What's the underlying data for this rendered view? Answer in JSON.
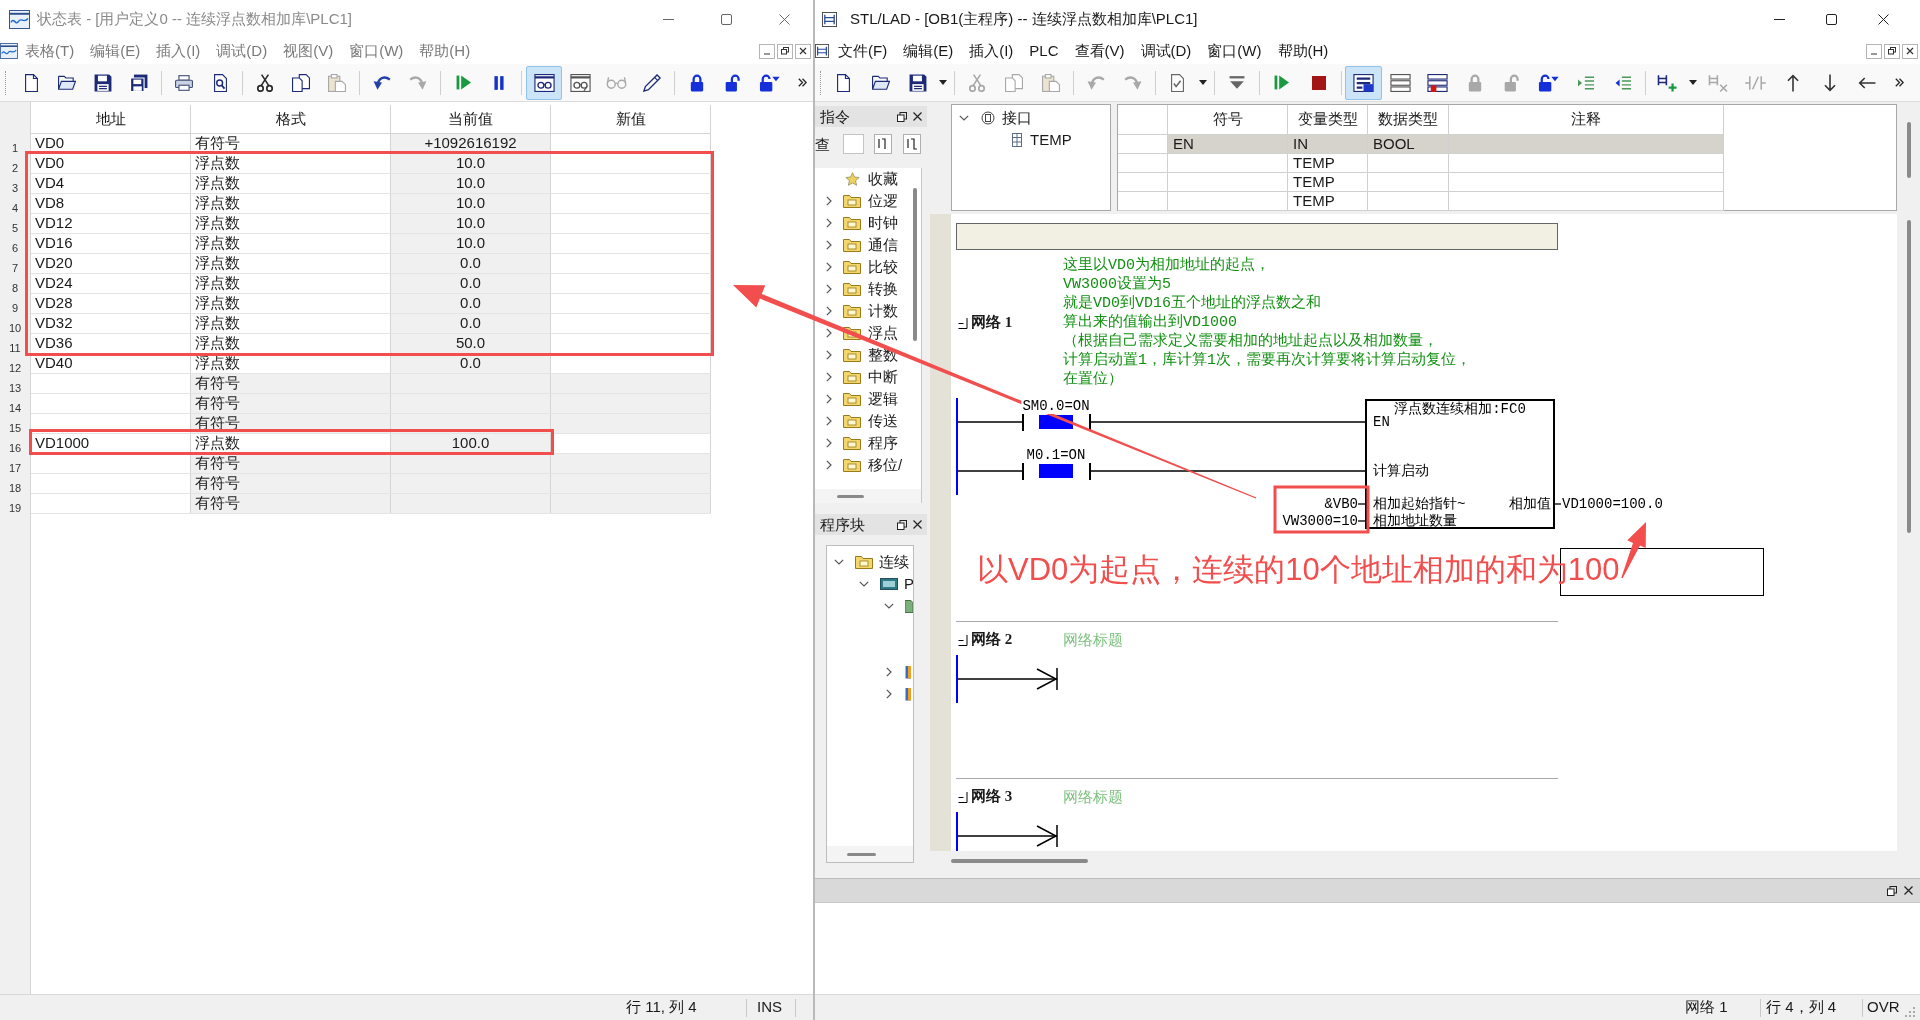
{
  "status_chart_window": {
    "title": "状态表 - [用户定义0 -- 连续浮点数相加库\\PLC1]",
    "active": false,
    "menu": [
      "表格(T)",
      "编辑(E)",
      "插入(I)",
      "调试(D)",
      "视图(V)",
      "窗口(W)",
      "帮助(H)"
    ],
    "toolbar_groups": [
      {
        "buttons": [
          {
            "kind": "new",
            "disabled": false,
            "pressed": false,
            "dropdown": false
          },
          {
            "kind": "open",
            "disabled": false,
            "pressed": false,
            "dropdown": false
          },
          {
            "kind": "save",
            "disabled": false,
            "pressed": false,
            "dropdown": false
          },
          {
            "kind": "save-all",
            "disabled": false,
            "pressed": false,
            "dropdown": false
          }
        ]
      },
      {
        "buttons": [
          {
            "kind": "print",
            "disabled": false,
            "pressed": false,
            "dropdown": false
          },
          {
            "kind": "preview",
            "disabled": false,
            "pressed": false,
            "dropdown": false
          }
        ]
      },
      {
        "buttons": [
          {
            "kind": "cut",
            "disabled": false,
            "pressed": false,
            "dropdown": false
          },
          {
            "kind": "copy",
            "disabled": false,
            "pressed": false,
            "dropdown": false
          },
          {
            "kind": "paste",
            "disabled": true,
            "pressed": false,
            "dropdown": false
          }
        ]
      },
      {
        "buttons": [
          {
            "kind": "undo",
            "disabled": false,
            "pressed": false,
            "dropdown": false
          },
          {
            "kind": "redo",
            "disabled": true,
            "pressed": false,
            "dropdown": false
          }
        ]
      },
      {
        "buttons": [
          {
            "kind": "run",
            "disabled": false,
            "pressed": false,
            "dropdown": false
          },
          {
            "kind": "pause",
            "disabled": false,
            "pressed": false,
            "dropdown": false
          }
        ]
      },
      {
        "buttons": [
          {
            "kind": "chart-status",
            "disabled": false,
            "pressed": true,
            "dropdown": false
          },
          {
            "kind": "trend",
            "disabled": false,
            "pressed": false,
            "dropdown": false
          },
          {
            "kind": "glasses",
            "disabled": true,
            "pressed": false,
            "dropdown": false
          },
          {
            "kind": "pen",
            "disabled": false,
            "pressed": false,
            "dropdown": false
          }
        ]
      },
      {
        "buttons": [
          {
            "kind": "lock",
            "disabled": false,
            "pressed": false,
            "dropdown": false
          },
          {
            "kind": "unlock",
            "disabled": false,
            "pressed": false,
            "dropdown": false
          },
          {
            "kind": "lock-menu",
            "disabled": false,
            "pressed": false,
            "dropdown": false
          }
        ]
      }
    ],
    "table": {
      "columns": [
        "地址",
        "格式",
        "当前值",
        "新值"
      ],
      "rows": [
        {
          "number": "1",
          "address": "VD0",
          "format": "有符号",
          "value": "+1092616192"
        },
        {
          "number": "2",
          "address": "VD0",
          "format": "浮点数",
          "value": "10.0"
        },
        {
          "number": "3",
          "address": "VD4",
          "format": "浮点数",
          "value": "10.0"
        },
        {
          "number": "4",
          "address": "VD8",
          "format": "浮点数",
          "value": "10.0"
        },
        {
          "number": "5",
          "address": "VD12",
          "format": "浮点数",
          "value": "10.0"
        },
        {
          "number": "6",
          "address": "VD16",
          "format": "浮点数",
          "value": "10.0"
        },
        {
          "number": "7",
          "address": "VD20",
          "format": "浮点数",
          "value": "0.0"
        },
        {
          "number": "8",
          "address": "VD24",
          "format": "浮点数",
          "value": "0.0"
        },
        {
          "number": "9",
          "address": "VD28",
          "format": "浮点数",
          "value": "0.0"
        },
        {
          "number": "10",
          "address": "VD32",
          "format": "浮点数",
          "value": "0.0"
        },
        {
          "number": "11",
          "address": "VD36",
          "format": "浮点数",
          "value": "50.0"
        },
        {
          "number": "12",
          "address": "VD40",
          "format": "浮点数",
          "value": "0.0"
        },
        {
          "number": "13",
          "format": "有符号"
        },
        {
          "number": "14",
          "format": "有符号"
        },
        {
          "number": "15",
          "format": "有符号"
        },
        {
          "number": "16",
          "address": "VD1000",
          "format": "浮点数",
          "value": "100.0"
        },
        {
          "number": "17",
          "format": "有符号"
        },
        {
          "number": "18",
          "format": "有符号"
        },
        {
          "number": "19",
          "format": "有符号"
        }
      ]
    },
    "status_bar": [
      "行 11, 列 4",
      "INS"
    ]
  },
  "editor_window": {
    "title": "STL/LAD - [OB1(主程序) -- 连续浮点数相加库\\PLC1]",
    "active": true,
    "menu": [
      "文件(F)",
      "编辑(E)",
      "插入(I)",
      "PLC",
      "查看(V)",
      "调试(D)",
      "窗口(W)",
      "帮助(H)"
    ],
    "toolbar_groups": [
      {
        "buttons": [
          {
            "kind": "new",
            "disabled": false,
            "pressed": false,
            "dropdown": false
          },
          {
            "kind": "open",
            "disabled": false,
            "pressed": false,
            "dropdown": false
          },
          {
            "kind": "save",
            "disabled": false,
            "pressed": false,
            "dropdown": true
          }
        ]
      },
      {
        "buttons": [
          {
            "kind": "cut",
            "disabled": true,
            "pressed": false,
            "dropdown": false
          },
          {
            "kind": "copy",
            "disabled": true,
            "pressed": false,
            "dropdown": false
          },
          {
            "kind": "paste",
            "disabled": true,
            "pressed": false,
            "dropdown": false
          }
        ]
      },
      {
        "buttons": [
          {
            "kind": "undo",
            "disabled": true,
            "pressed": false,
            "dropdown": false
          },
          {
            "kind": "redo",
            "disabled": true,
            "pressed": false,
            "dropdown": false
          }
        ]
      },
      {
        "buttons": [
          {
            "kind": "compile",
            "disabled": false,
            "pressed": false,
            "dropdown": true
          }
        ]
      },
      {
        "buttons": [
          {
            "kind": "download",
            "disabled": false,
            "pressed": false,
            "dropdown": false
          }
        ]
      },
      {
        "buttons": [
          {
            "kind": "run",
            "disabled": false,
            "pressed": false,
            "dropdown": false
          },
          {
            "kind": "stop",
            "disabled": false,
            "pressed": false,
            "dropdown": false
          }
        ]
      },
      {
        "buttons": [
          {
            "kind": "program-status",
            "disabled": false,
            "pressed": true,
            "dropdown": false
          },
          {
            "kind": "status-list",
            "disabled": false,
            "pressed": false,
            "dropdown": false
          },
          {
            "kind": "status-force",
            "disabled": false,
            "pressed": false,
            "dropdown": false
          },
          {
            "kind": "lock",
            "disabled": true,
            "pressed": false,
            "dropdown": false
          },
          {
            "kind": "unlock",
            "disabled": true,
            "pressed": false,
            "dropdown": false
          },
          {
            "kind": "lock-menu",
            "disabled": false,
            "pressed": false,
            "dropdown": false
          },
          {
            "kind": "indent",
            "disabled": false,
            "pressed": false,
            "dropdown": false
          },
          {
            "kind": "outdent",
            "disabled": false,
            "pressed": false,
            "dropdown": false
          }
        ]
      },
      {
        "buttons": [
          {
            "kind": "insert-network",
            "disabled": false,
            "pressed": false,
            "dropdown": true
          },
          {
            "kind": "delete-network",
            "disabled": true,
            "pressed": false,
            "dropdown": false
          },
          {
            "kind": "negate",
            "disabled": true,
            "pressed": false,
            "dropdown": false
          },
          {
            "kind": "up",
            "disabled": false,
            "pressed": false,
            "dropdown": false
          },
          {
            "kind": "down",
            "disabled": false,
            "pressed": false,
            "dropdown": false
          },
          {
            "kind": "left",
            "disabled": false,
            "pressed": false,
            "dropdown": false
          }
        ]
      }
    ],
    "instructions_panel": {
      "title": "指令",
      "search_label": "查",
      "items": [
        {
          "kind": "favorites",
          "label": "收藏"
        },
        {
          "kind": "folder",
          "label": "位逻",
          "expanded": false
        },
        {
          "kind": "folder",
          "label": "时钟",
          "expanded": false
        },
        {
          "kind": "folder",
          "label": "通信",
          "expanded": false
        },
        {
          "kind": "folder",
          "label": "比较",
          "expanded": false
        },
        {
          "kind": "folder",
          "label": "转换",
          "expanded": false
        },
        {
          "kind": "folder",
          "label": "计数",
          "expanded": false
        },
        {
          "kind": "folder",
          "label": "浮点",
          "expanded": false
        },
        {
          "kind": "folder",
          "label": "整数",
          "expanded": false
        },
        {
          "kind": "folder",
          "label": "中断",
          "expanded": false
        },
        {
          "kind": "folder",
          "label": "逻辑",
          "expanded": false
        },
        {
          "kind": "folder",
          "label": "传送",
          "expanded": false
        },
        {
          "kind": "folder",
          "label": "程序",
          "expanded": false
        },
        {
          "kind": "folder",
          "label": "移位/",
          "expanded": false
        }
      ]
    },
    "program_blocks_panel": {
      "title": "程序块",
      "tree": [
        {
          "kind": "project",
          "label": "连续",
          "expanded": true,
          "children": [
            {
              "kind": "plc",
              "label": "P",
              "expanded": true,
              "children": [
                {
                  "kind": "block-folder",
                  "expanded": true
                },
                {
                  "kind": "library",
                  "expanded": false
                },
                {
                  "kind": "library",
                  "expanded": false
                }
              ]
            }
          ]
        }
      ]
    },
    "interface": {
      "label": "接口",
      "expanded": true,
      "children": [
        {
          "label": "TEMP"
        }
      ]
    },
    "variables": {
      "columns": [
        "符号",
        "变量类型",
        "数据类型",
        "注释"
      ],
      "rows": [
        {
          "symbol": "EN",
          "var_type": "IN",
          "data_type": "BOOL",
          "highlighted": true
        },
        {
          "var_type": "TEMP",
          "highlighted": false
        },
        {
          "var_type": "TEMP",
          "highlighted": false
        },
        {
          "var_type": "TEMP",
          "highlighted": false
        }
      ]
    },
    "networks": [
      {
        "kind": "ladder",
        "label": "网络 1",
        "selected": true,
        "comment": [
          "这里以VD0为相加地址的起点，",
          "VW3000设置为5",
          "就是VD0到VD16五个地址的浮点数之和",
          "算出来的值输出到VD1000",
          "（根据自己需求定义需要相加的地址起点以及相加数量，",
          "计算启动置1，库计算1次，需要再次计算要将计算启动复位，",
          "在置位）"
        ],
        "contacts": [
          {
            "label": "SM0.0=ON",
            "on": true
          },
          {
            "label": "M0.1=ON",
            "on": true
          }
        ],
        "block": {
          "title": "浮点数连续相加:FC0",
          "inputs": [
            {
              "pin": "EN"
            },
            {
              "pin": "计算启动"
            },
            {
              "pin": "相加起始指针~",
              "operand": "&VB0"
            },
            {
              "pin": "相加地址数量",
              "operand": "VW3000=10"
            }
          ],
          "outputs": [
            {
              "pin": "相加值",
              "operand": "VD1000=100.0"
            }
          ]
        }
      },
      {
        "kind": "empty",
        "label": "网络 2",
        "selected": false,
        "title": "网络标题"
      },
      {
        "kind": "empty",
        "label": "网络 3",
        "selected": false,
        "title": "网络标题"
      }
    ],
    "status_bar": [
      "网络 1",
      "行 4，列 4",
      "OVR"
    ]
  },
  "annotation": {
    "text": "以VD0为起点，连续的10个地址相加的和为100"
  }
}
